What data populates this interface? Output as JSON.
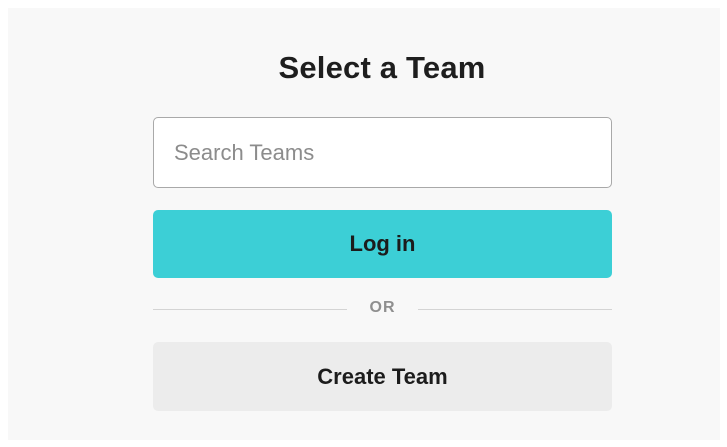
{
  "header": {
    "title": "Select a Team"
  },
  "search": {
    "placeholder": "Search Teams",
    "value": ""
  },
  "actions": {
    "login_label": "Log in",
    "divider_label": "OR",
    "create_label": "Create Team"
  },
  "colors": {
    "accent": "#3ccfd6",
    "secondary_button": "#ececec",
    "background": "#f8f8f8"
  }
}
